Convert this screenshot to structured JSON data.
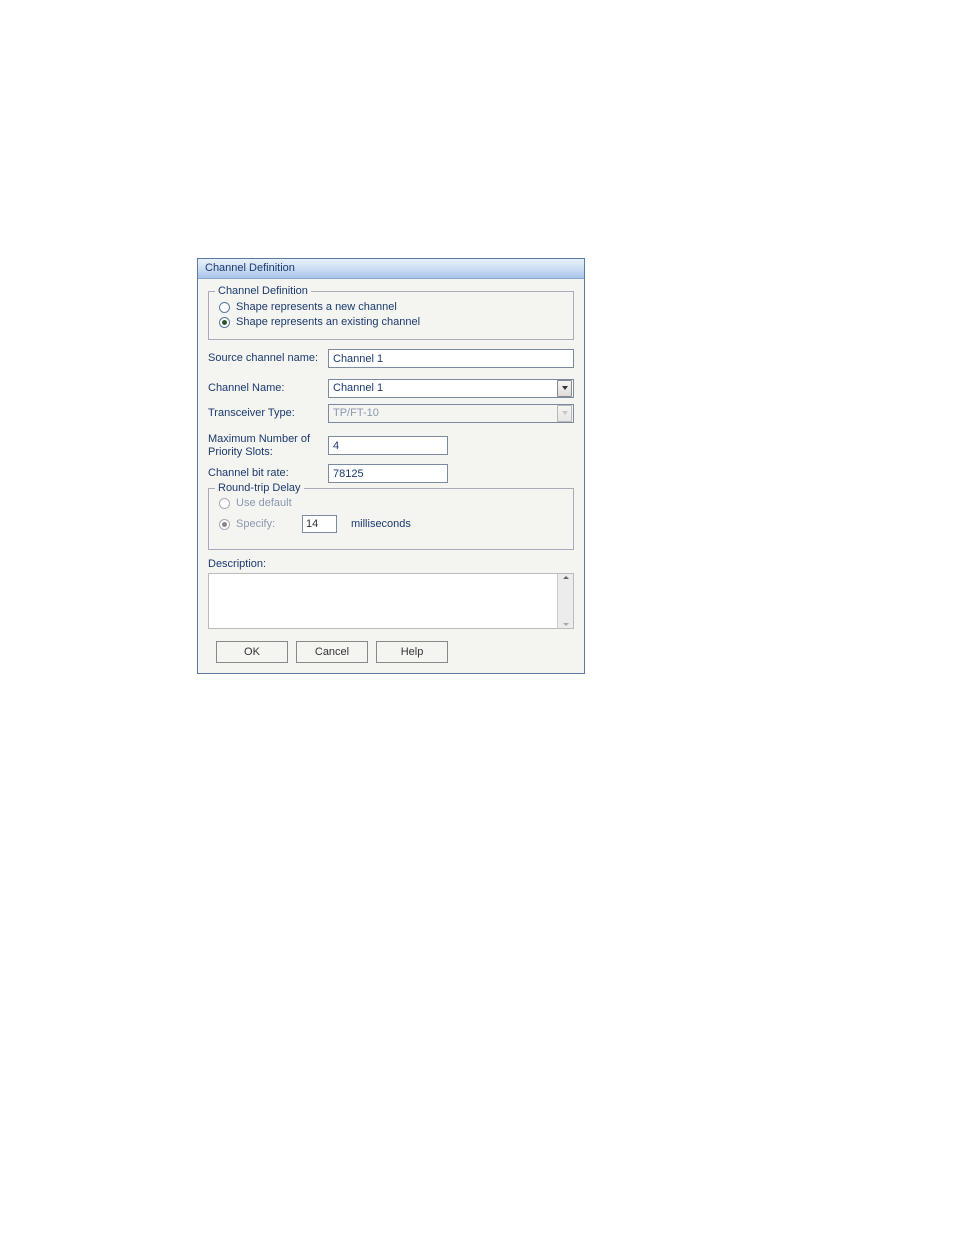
{
  "dialog": {
    "title": "Channel Definition",
    "channel_def_group": {
      "legend": "Channel Definition",
      "option_new": "Shape represents a new channel",
      "option_existing": "Shape represents an existing channel",
      "selected": "existing"
    },
    "fields": {
      "source_channel_label": "Source channel name:",
      "source_channel_value": "Channel 1",
      "channel_name_label": "Channel Name:",
      "channel_name_value": "Channel 1",
      "transceiver_type_label": "Transceiver Type:",
      "transceiver_type_value": "TP/FT-10",
      "max_priority_label": "Maximum  Number of Priority Slots:",
      "max_priority_value": "4",
      "channel_bitrate_label": "Channel bit rate:",
      "channel_bitrate_value": "78125"
    },
    "rtd": {
      "legend": "Round-trip Delay",
      "option_default": "Use default",
      "option_specify": "Specify:",
      "specify_value": "14",
      "unit": "milliseconds",
      "selected": "specify"
    },
    "description_label": "Description:",
    "description_value": "",
    "buttons": {
      "ok": "OK",
      "cancel": "Cancel",
      "help": "Help"
    }
  }
}
